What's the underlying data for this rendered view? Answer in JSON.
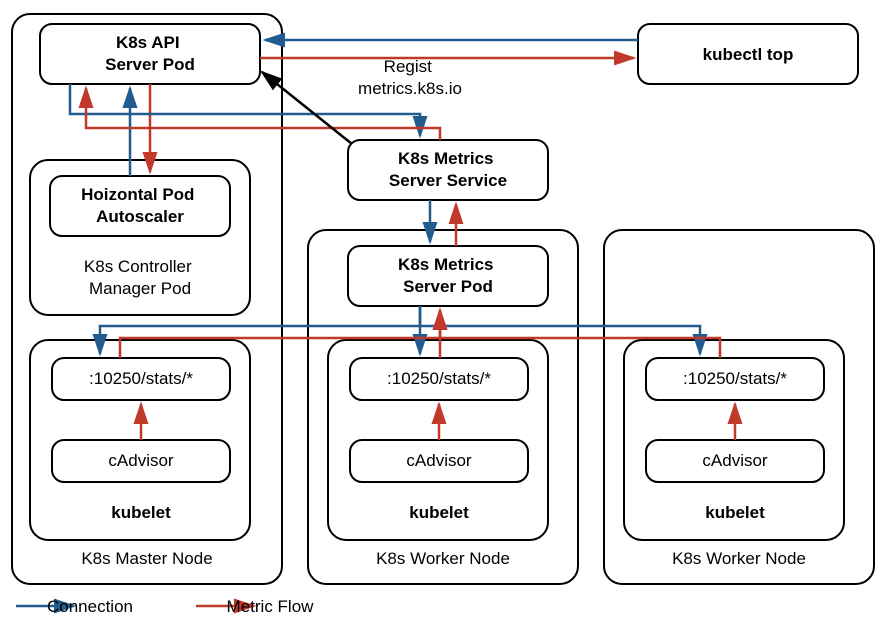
{
  "boxes": {
    "api_server": "K8s API\nServer Pod",
    "kubectl_top": "kubectl top",
    "hpa": "Hoizontal Pod\nAutoscaler",
    "controller_mgr": "K8s Controller\nManager Pod",
    "metrics_service": "K8s Metrics\nServer Service",
    "metrics_pod": "K8s Metrics\nServer Pod",
    "stats": ":10250/stats/*",
    "cadvisor": "cAdvisor",
    "kubelet": "kubelet",
    "master_node": "K8s Master Node",
    "worker_node": "K8s Worker Node"
  },
  "labels": {
    "regist": "Regist\nmetrics.k8s.io",
    "connection": "Connection",
    "metric_flow": "Metric Flow"
  }
}
